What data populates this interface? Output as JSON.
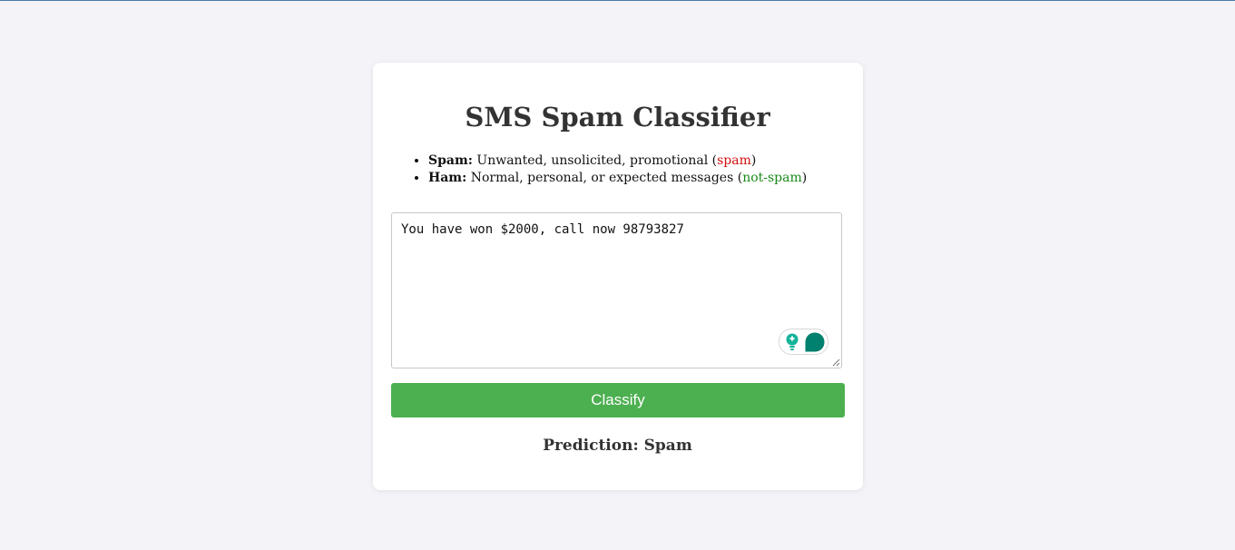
{
  "app": {
    "title": "SMS Spam Classifier"
  },
  "legend": {
    "spam": {
      "term": "Spam:",
      "description": " Unwanted, unsolicited, promotional (",
      "tag": "spam",
      "close": ")"
    },
    "ham": {
      "term": "Ham:",
      "description": " Normal, personal, or expected messages (",
      "tag": "not-spam",
      "close": ")"
    }
  },
  "message": {
    "value": "You have won $2000, call now 98793827"
  },
  "assistant_widget": {
    "icons": [
      "lightbulb-icon",
      "chat-bubble-icon"
    ],
    "color": "#00806e"
  },
  "actions": {
    "classify_label": "Classify"
  },
  "result": {
    "prediction_text": "Prediction: Spam"
  },
  "colors": {
    "background": "#f3f3f8",
    "card": "#ffffff",
    "button": "#4caf50",
    "spam": "#d01010",
    "ham": "#1a8a1a"
  }
}
